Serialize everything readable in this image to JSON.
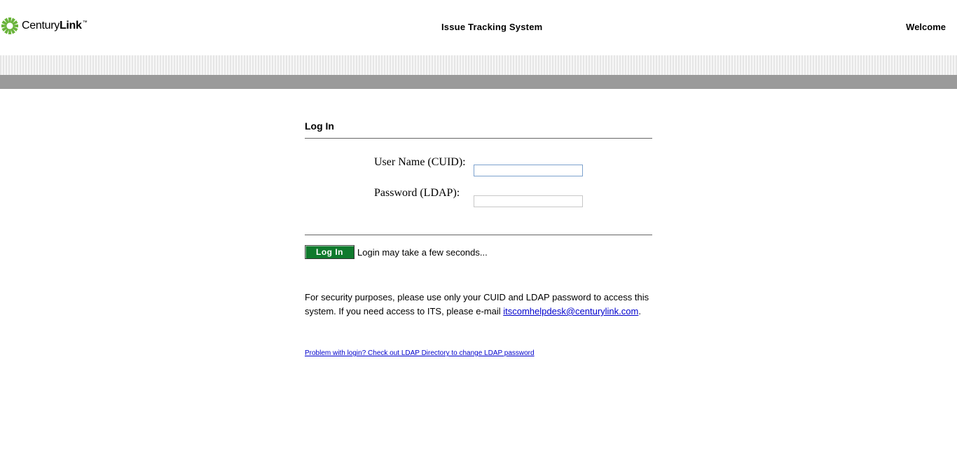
{
  "header": {
    "logo": {
      "text_regular": "Century",
      "text_bold": "Link",
      "trademark": "™",
      "icon": "centurylink-sunburst-icon",
      "brand_color": "#69b33a"
    },
    "app_title": "Issue Tracking System",
    "welcome": "Welcome"
  },
  "login": {
    "title": "Log In",
    "username_label": "User Name (CUID):",
    "username_value": "",
    "password_label": "Password (LDAP):",
    "password_value": "",
    "button_label": "Log In",
    "button_color": "#0f7a2d",
    "note": "Login may take a few seconds..."
  },
  "security": {
    "text_before": "For security purposes, please use only your CUID and LDAP password to access this system. If you need access to ITS, please e-mail ",
    "email": "itscomhelpdesk@centurylink.com",
    "text_after": "."
  },
  "ldap_link": "Problem with login? Check out LDAP Directory to change LDAP password",
  "colors": {
    "band_gray": "#9a9a9a",
    "link": "#0000cc"
  }
}
